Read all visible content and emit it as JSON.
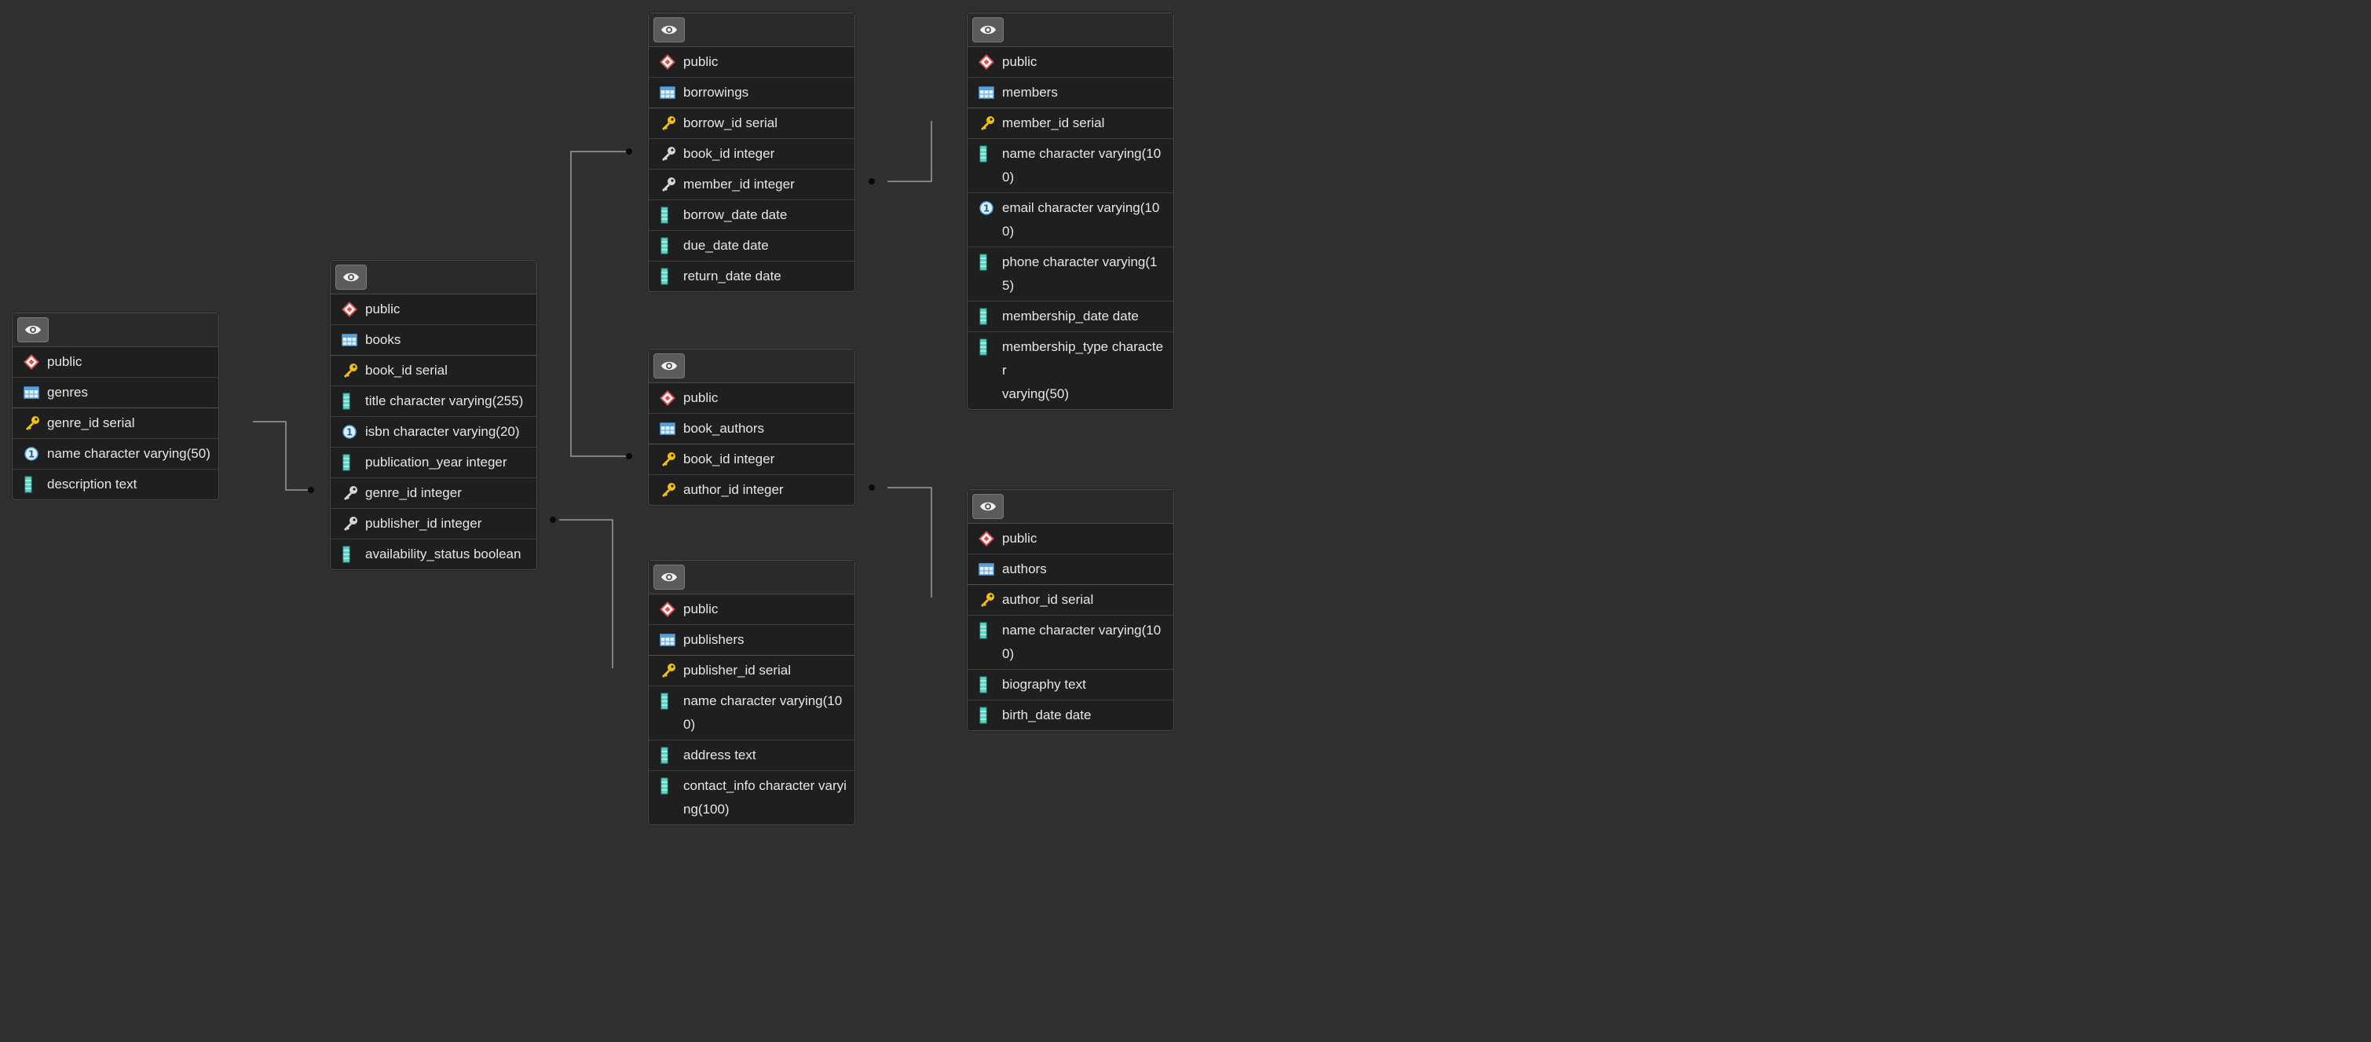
{
  "tables": [
    {
      "id": "genres",
      "schema": "public",
      "name": "genres",
      "columns": [
        {
          "text": "genre_id serial",
          "icon": "primary-key-icon"
        },
        {
          "text": "name character varying(50)",
          "icon": "unique-icon"
        },
        {
          "text": "description text",
          "icon": "column-icon"
        }
      ]
    },
    {
      "id": "books",
      "schema": "public",
      "name": "books",
      "columns": [
        {
          "text": "book_id serial",
          "icon": "primary-key-icon"
        },
        {
          "text": "title character varying(255)",
          "icon": "column-icon"
        },
        {
          "text": "isbn character varying(20)",
          "icon": "unique-icon"
        },
        {
          "text": "publication_year integer",
          "icon": "column-icon"
        },
        {
          "text": "genre_id integer",
          "icon": "foreign-key-icon"
        },
        {
          "text": "publisher_id integer",
          "icon": "foreign-key-icon"
        },
        {
          "text": "availability_status boolean",
          "icon": "column-icon"
        }
      ]
    },
    {
      "id": "borrowings",
      "schema": "public",
      "name": "borrowings",
      "columns": [
        {
          "text": "borrow_id serial",
          "icon": "primary-key-icon"
        },
        {
          "text": "book_id integer",
          "icon": "foreign-key-icon"
        },
        {
          "text": "member_id integer",
          "icon": "foreign-key-icon"
        },
        {
          "text": "borrow_date date",
          "icon": "column-icon"
        },
        {
          "text": "due_date date",
          "icon": "column-icon"
        },
        {
          "text": "return_date date",
          "icon": "column-icon"
        }
      ]
    },
    {
      "id": "book_authors",
      "schema": "public",
      "name": "book_authors",
      "columns": [
        {
          "text": "book_id integer",
          "icon": "primary-key-icon"
        },
        {
          "text": "author_id integer",
          "icon": "primary-key-icon"
        }
      ]
    },
    {
      "id": "publishers",
      "schema": "public",
      "name": "publishers",
      "columns": [
        {
          "text": "publisher_id serial",
          "icon": "primary-key-icon"
        },
        {
          "text": "name character varying(10\n0)",
          "icon": "column-icon"
        },
        {
          "text": "address text",
          "icon": "column-icon"
        },
        {
          "text": "contact_info character varyi\nng(100)",
          "icon": "column-icon"
        }
      ]
    },
    {
      "id": "members",
      "schema": "public",
      "name": "members",
      "columns": [
        {
          "text": "member_id serial",
          "icon": "primary-key-icon"
        },
        {
          "text": "name character varying(10\n0)",
          "icon": "column-icon"
        },
        {
          "text": "email character varying(10\n0)",
          "icon": "unique-icon"
        },
        {
          "text": "phone character varying(15)\n ",
          "icon": "column-icon"
        },
        {
          "text": "membership_date date",
          "icon": "column-icon"
        },
        {
          "text": "membership_type character\nvarying(50)",
          "icon": "column-icon"
        }
      ]
    },
    {
      "id": "authors",
      "schema": "public",
      "name": "authors",
      "columns": [
        {
          "text": "author_id serial",
          "icon": "primary-key-icon"
        },
        {
          "text": "name character varying(10\n0)",
          "icon": "column-icon"
        },
        {
          "text": "biography text",
          "icon": "column-icon"
        },
        {
          "text": "birth_date date",
          "icon": "column-icon"
        }
      ]
    }
  ],
  "icons": {
    "eye": "eye-icon",
    "schema": "schema-icon",
    "table": "table-icon"
  },
  "colors": {
    "background": "#303030",
    "table_bg": "#1f1f1f",
    "key_yellow": "#f2c012",
    "column_teal": "#5fd3c4",
    "schema_red": "#d9534f",
    "unique_blue": "#4fa3e0"
  }
}
